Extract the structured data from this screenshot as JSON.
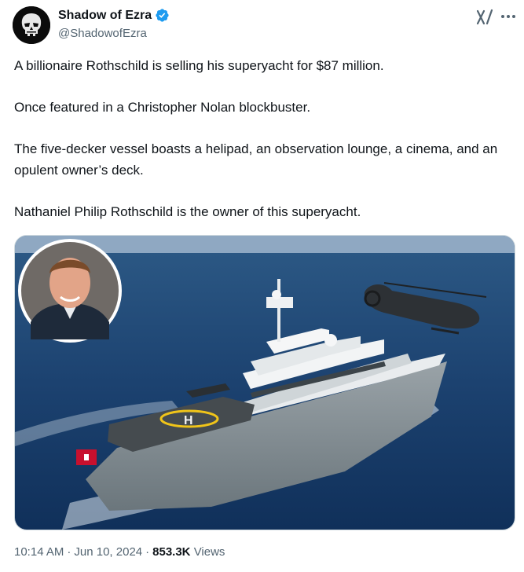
{
  "author": {
    "display_name": "Shadow of Ezra",
    "handle": "@ShadowofEzra",
    "verified": true,
    "avatar_icon": "skull-avatar-icon"
  },
  "actions": {
    "grok_icon": "grok-icon",
    "more_icon": "more-options-icon"
  },
  "tweet": {
    "paragraphs": [
      "A billionaire Rothschild is selling his superyacht for $87 million.",
      "Once featured in a Christopher Nolan blockbuster.",
      "The five-decker vessel boasts a helipad, an observation lounge, a cinema, and an opulent owner’s deck.",
      "Nathaniel Philip Rothschild is the owner of this superyacht."
    ]
  },
  "media": {
    "helipad_letter": "H"
  },
  "meta": {
    "time": "10:14 AM",
    "date": "Jun 10, 2024",
    "views_count": "853.3K",
    "views_label": "Views"
  },
  "colors": {
    "verified_blue": "#1d9bf0",
    "muted_text": "#536471",
    "primary_text": "#0f1419"
  }
}
